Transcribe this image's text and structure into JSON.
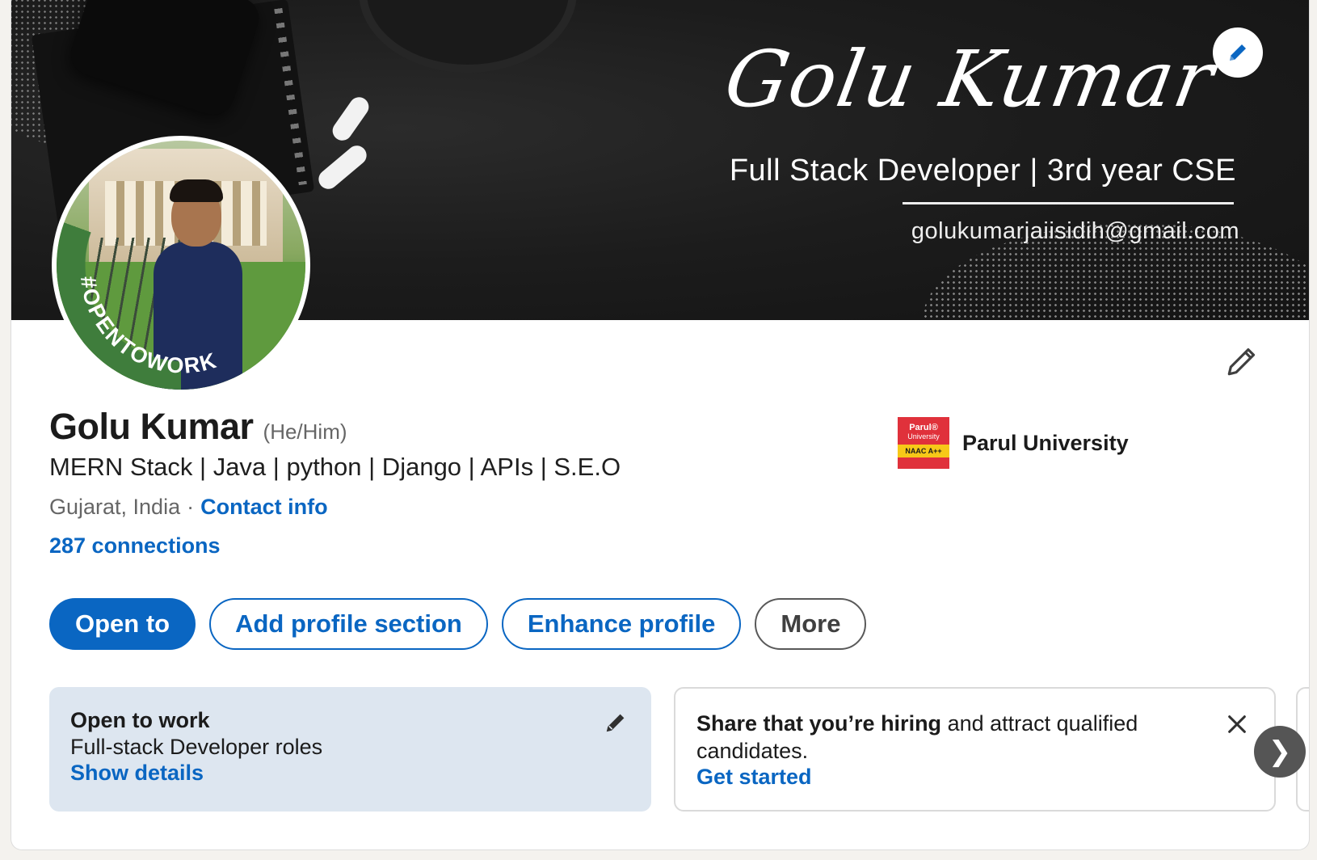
{
  "banner": {
    "script_name": "Golu Kumar",
    "tagline": "Full Stack Developer | 3rd year CSE",
    "email": "golukumarjaiisidih@gmail.com"
  },
  "avatar": {
    "frame_text": "#OPENTOWORK"
  },
  "profile": {
    "name": "Golu Kumar",
    "pronouns": "(He/Him)",
    "headline": "MERN Stack | Java | python | Django | APIs | S.E.O",
    "location": "Gujarat, India",
    "separator": "·",
    "contact_info": "Contact info",
    "connections": "287 connections"
  },
  "education": {
    "name": "Parul University",
    "logo_line1": "Parul®",
    "logo_line2": "University",
    "logo_band": "NAAC A++"
  },
  "actions": {
    "open_to": "Open to",
    "add_section": "Add profile section",
    "enhance": "Enhance profile",
    "more": "More"
  },
  "open_to_work_card": {
    "title": "Open to work",
    "roles": "Full-stack Developer roles",
    "link": "Show details"
  },
  "hiring_card": {
    "bold": "Share that you’re hiring",
    "rest": " and attract qualified",
    "line2": "candidates.",
    "link": "Get started"
  },
  "carousel": {
    "next_glyph": "❯"
  },
  "colors": {
    "accent": "#0a66c2",
    "otw_green": "#3f7d3c",
    "card_blue": "#dde6f0",
    "banner_dark": "#1c1c1c"
  }
}
